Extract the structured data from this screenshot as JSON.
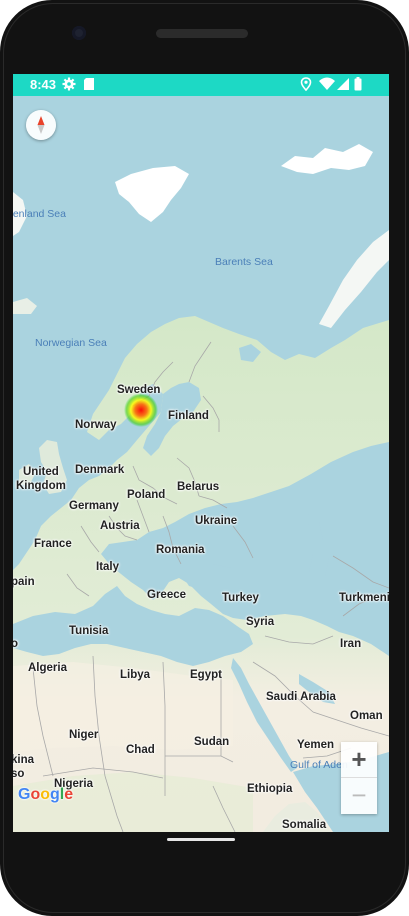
{
  "status_bar": {
    "time": "8:43",
    "icons": [
      "gear-icon",
      "sd-card-icon",
      "location-icon",
      "wifi-icon",
      "signal-icon",
      "battery-icon"
    ]
  },
  "map": {
    "provider": "Google",
    "colors": {
      "water": "#aad3df",
      "land_north": "#dcebd3",
      "land_south": "#f3ede2",
      "status_bar": "#1dd9c5"
    },
    "heatmap": {
      "location": "Sweden",
      "colors": [
        "#ff0000",
        "#ffff00",
        "#00d400"
      ]
    },
    "seas": {
      "greenland": "eenland Sea",
      "barents": "Barents Sea",
      "norwegian": "Norwegian Sea",
      "gulf_aden": "Gulf of Aden"
    },
    "countries": {
      "sweden": "Sweden",
      "finland": "Finland",
      "norway": "Norway",
      "uk": "United Kingdom",
      "uk_line1": "United",
      "uk_line2": "Kingdom",
      "denmark": "Denmark",
      "poland": "Poland",
      "belarus": "Belarus",
      "germany": "Germany",
      "ukraine": "Ukraine",
      "austria": "Austria",
      "france": "France",
      "romania": "Romania",
      "italy": "Italy",
      "spain": "pain",
      "greece": "Greece",
      "turkey": "Turkey",
      "turkmenistan": "Turkmenis",
      "tunisia": "Tunisia",
      "syria": "Syria",
      "iran": "Iran",
      "algeria": "Algeria",
      "libya": "Libya",
      "egypt": "Egypt",
      "saudi_arabia": "Saudi Arabia",
      "oman": "Oman",
      "niger": "Niger",
      "chad": "Chad",
      "sudan": "Sudan",
      "yemen": "Yemen",
      "burkina": "kina",
      "burkina2": "so",
      "nigeria": "Nigeria",
      "ethiopia": "Ethiopia",
      "somalia": "Somalia",
      "morocco": "o"
    }
  },
  "controls": {
    "zoom_in": "+",
    "zoom_out": "−",
    "compass_icon": "compass-icon"
  }
}
